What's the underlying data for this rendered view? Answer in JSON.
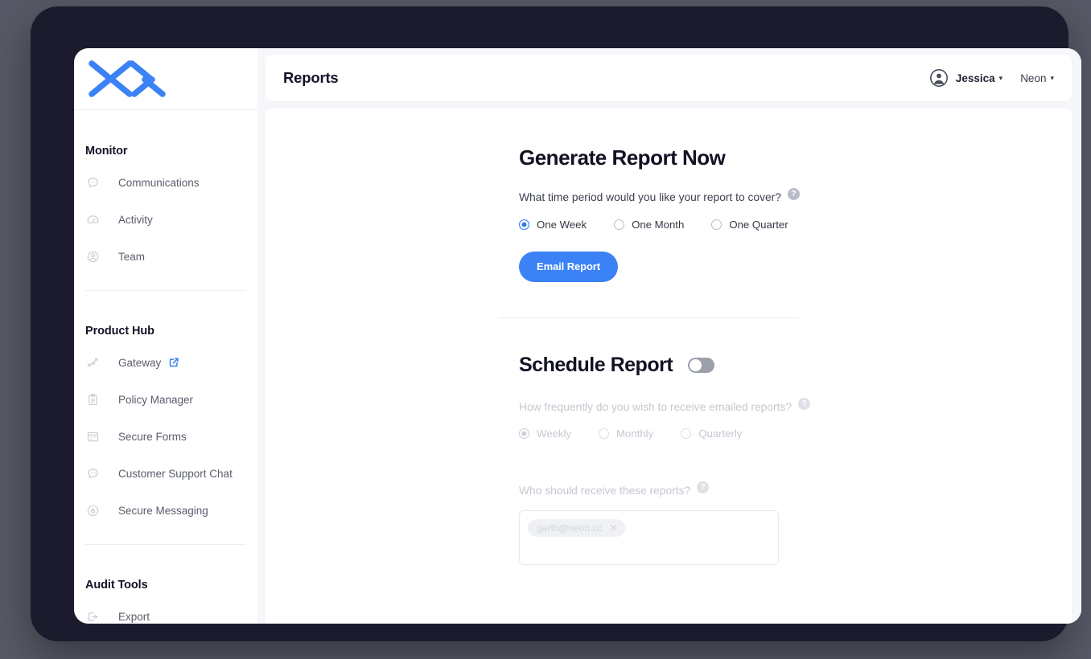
{
  "brand": {
    "logo_name": "chevron-logo",
    "accent_color": "#3b82f6",
    "frame_color": "#1c1b2e",
    "page_bg": "#575a66"
  },
  "header": {
    "title": "Reports",
    "user": {
      "name": "Jessica",
      "caret": "▾",
      "avatar_icon": "user-avatar-icon"
    },
    "org": {
      "name": "Neon",
      "caret": "▾"
    }
  },
  "sidebar": {
    "sections": [
      {
        "title": "Monitor",
        "items": [
          {
            "label": "Communications",
            "icon": "chat-bubble-icon",
            "external": false
          },
          {
            "label": "Activity",
            "icon": "gauge-icon",
            "external": false
          },
          {
            "label": "Team",
            "icon": "user-circle-icon",
            "external": false
          }
        ]
      },
      {
        "title": "Product Hub",
        "items": [
          {
            "label": "Gateway",
            "icon": "network-node-icon",
            "external": true,
            "external_icon": "external-link-icon"
          },
          {
            "label": "Policy Manager",
            "icon": "clipboard-icon",
            "external": false
          },
          {
            "label": "Secure Forms",
            "icon": "form-window-icon",
            "external": false
          },
          {
            "label": "Customer Support Chat",
            "icon": "chat-bubble-icon",
            "external": false
          },
          {
            "label": "Secure Messaging",
            "icon": "lock-bubble-icon",
            "external": false
          }
        ]
      },
      {
        "title": "Audit Tools",
        "items": [
          {
            "label": "Export",
            "icon": "export-arrow-icon",
            "external": false
          }
        ]
      }
    ]
  },
  "generate_report": {
    "heading": "Generate Report Now",
    "question": "What time period would you like your report to cover?",
    "help_icon": "help-question-icon",
    "help_glyph": "?",
    "options": [
      {
        "label": "One Week",
        "selected": true
      },
      {
        "label": "One Month",
        "selected": false
      },
      {
        "label": "One Quarter",
        "selected": false
      }
    ],
    "submit_label": "Email Report"
  },
  "schedule_report": {
    "heading": "Schedule Report",
    "toggle": {
      "name": "schedule-report-toggle",
      "state": "off"
    },
    "frequency_question": "How frequently do you wish to receive emailed reports?",
    "help_glyph": "?",
    "frequency_options": [
      {
        "label": "Weekly",
        "selected": true
      },
      {
        "label": "Monthly",
        "selected": false
      },
      {
        "label": "Quarterly",
        "selected": false
      }
    ],
    "recipients_question": "Who should receive these reports?",
    "recipients": [
      {
        "email": "garth@neon.cc",
        "remove_glyph": "✕"
      }
    ]
  }
}
